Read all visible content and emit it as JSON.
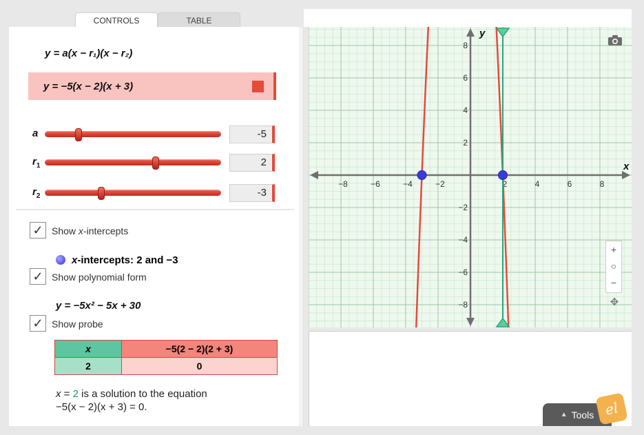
{
  "tabs": [
    {
      "label": "CONTROLS",
      "active": true
    },
    {
      "label": "TABLE",
      "active": false
    }
  ],
  "equations": {
    "general": "y = a(x − r₁)(x − r₂)",
    "specific": "y = −5(x − 2)(x + 3)",
    "curve_color": "#e54a3a"
  },
  "sliders": [
    {
      "label": "a",
      "sub": "",
      "value": "-5",
      "fraction": 0.19
    },
    {
      "label": "r",
      "sub": "1",
      "value": "2",
      "fraction": 0.63
    },
    {
      "label": "r",
      "sub": "2",
      "value": "-3",
      "fraction": 0.32
    }
  ],
  "options": {
    "show_intercepts": {
      "label_pre": "Show ",
      "label_var": "x",
      "label_post": "-intercepts",
      "checked": true
    },
    "intercepts_text_var": "x",
    "intercepts_text": "-intercepts: 2 and −3",
    "show_poly": {
      "label": "Show polynomial form",
      "checked": true
    },
    "poly_form": "y = −5x² − 5x + 30",
    "show_probe": {
      "label": "Show probe",
      "checked": true
    }
  },
  "probe_table": {
    "headers": [
      "x",
      "−5(2 − 2)(2 + 3)"
    ],
    "row": [
      "2",
      "0"
    ]
  },
  "solution": {
    "line1_var": "x",
    "line1_eq": " = ",
    "line1_val": "2",
    "line1_rest": " is a solution to the equation",
    "line2": "−5(x − 2)(x + 3) = 0."
  },
  "graph": {
    "x_label": "x",
    "y_label": "y",
    "x_ticks": [
      "−8",
      "−6",
      "−4",
      "−2",
      "2",
      "4",
      "6",
      "8"
    ],
    "y_ticks": [
      "8",
      "6",
      "4",
      "2",
      "−2",
      "−4",
      "−6",
      "−8"
    ],
    "axis_range": {
      "xmin": -10,
      "xmax": 10,
      "ymin": -9.5,
      "ymax": 9.5
    },
    "intercepts": [
      2,
      -3
    ],
    "probe_x": 2,
    "grid_color": "#b9dcbf",
    "probe_color": "#2aa57a",
    "point_color": "#3b3bdc"
  },
  "zoom": {
    "plus": "+",
    "reset": "○",
    "minus": "−"
  },
  "tools": {
    "label": "Tools"
  },
  "icons": {
    "camera": "camera-icon",
    "pan": "pan-icon",
    "logo": "logo-badge"
  }
}
